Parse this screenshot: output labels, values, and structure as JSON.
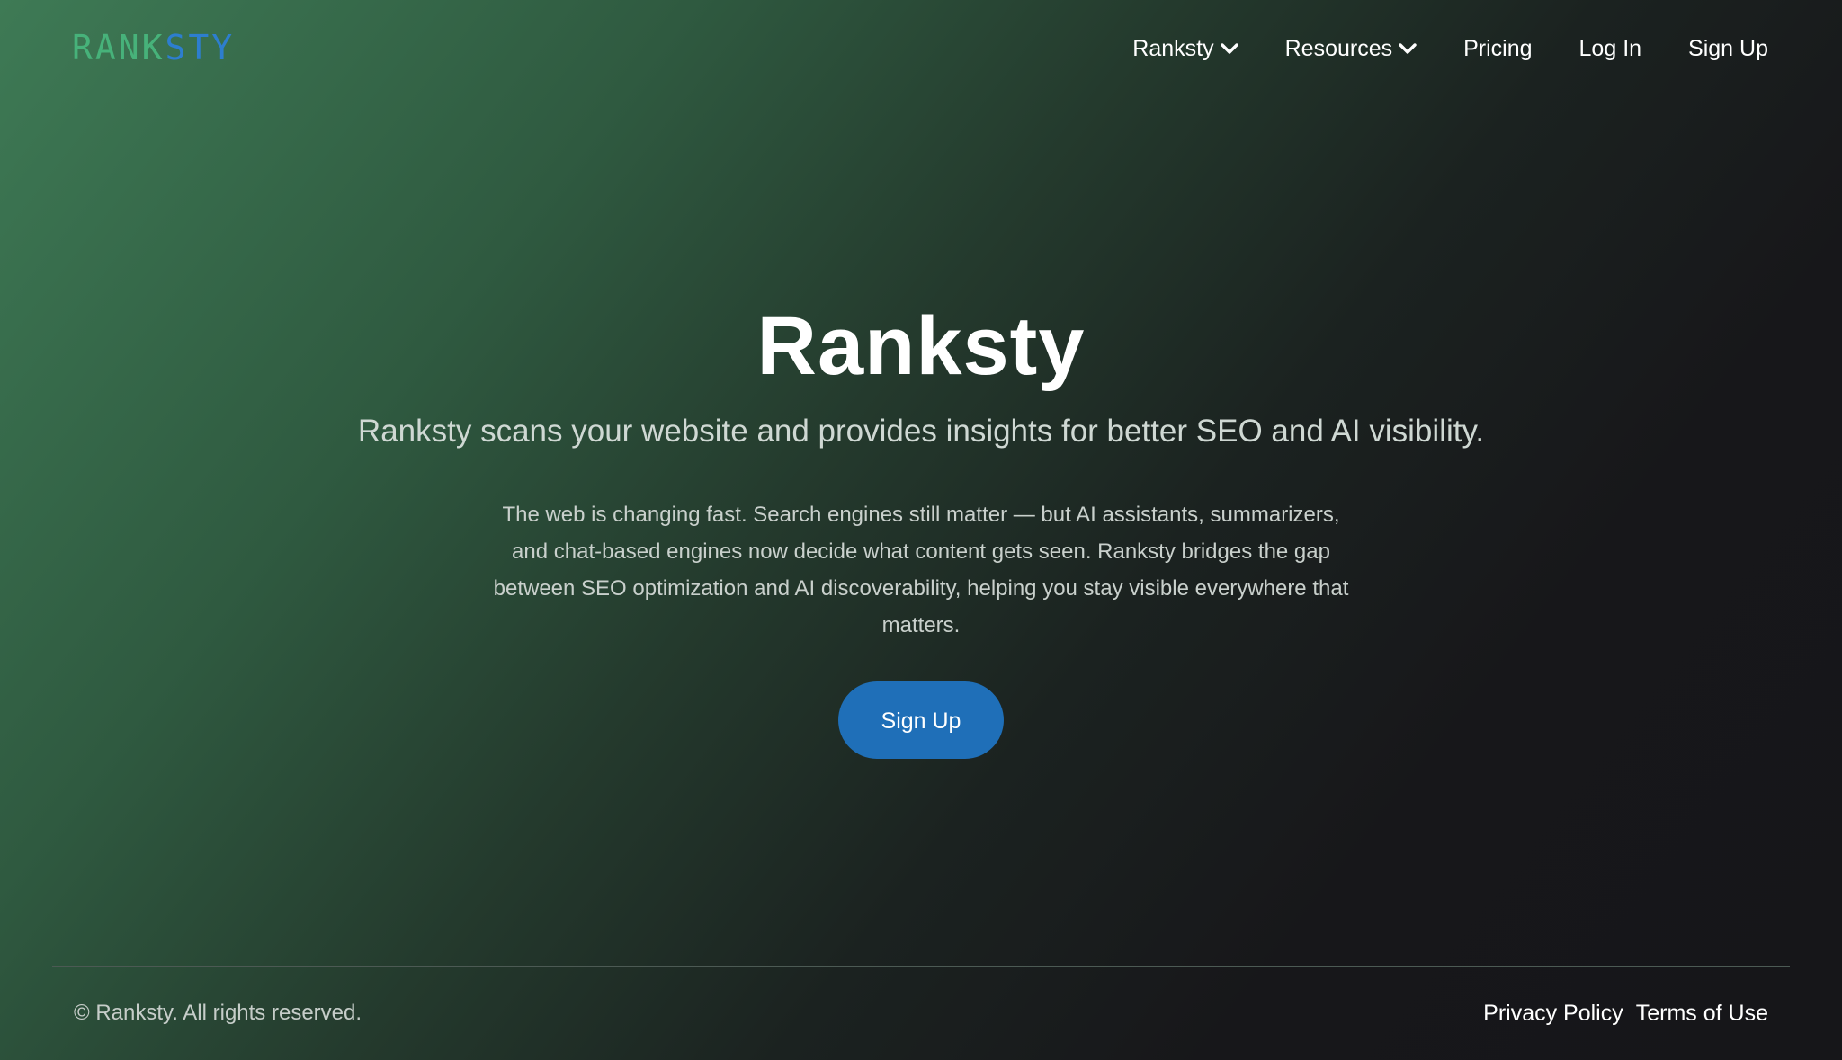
{
  "header": {
    "logo": {
      "part1": "RANK",
      "part2": "STY"
    },
    "nav": [
      {
        "label": "Ranksty",
        "has_dropdown": true
      },
      {
        "label": "Resources",
        "has_dropdown": true
      },
      {
        "label": "Pricing",
        "has_dropdown": false
      },
      {
        "label": "Log In",
        "has_dropdown": false
      },
      {
        "label": "Sign Up",
        "has_dropdown": false
      }
    ]
  },
  "hero": {
    "title": "Ranksty",
    "subtitle": "Ranksty scans your website and provides insights for better SEO and AI visibility.",
    "description": "The web is changing fast. Search engines still matter — but AI assistants, summarizers, and chat-based engines now decide what content gets seen. Ranksty bridges the gap between SEO optimization and AI discoverability, helping you stay visible everywhere that matters.",
    "cta_label": "Sign Up"
  },
  "footer": {
    "copyright": "© Ranksty. All rights reserved.",
    "links": [
      "Privacy Policy",
      "Terms of Use"
    ]
  },
  "colors": {
    "logo_green": "#47b27a",
    "logo_blue": "#2d7ecf",
    "cta_blue": "#1f6fb8",
    "bg_green": "#3e7a55",
    "bg_dark": "#161619"
  },
  "icons": {
    "dropdown": "chevron-down-icon"
  }
}
